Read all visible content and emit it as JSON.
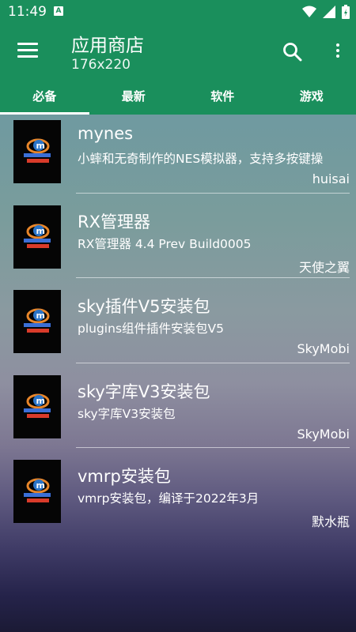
{
  "status": {
    "time": "11:49",
    "a_badge": "A"
  },
  "app_bar": {
    "title": "应用商店",
    "subtitle": "176x220"
  },
  "tabs": [
    {
      "label": "必备",
      "active": true
    },
    {
      "label": "最新",
      "active": false
    },
    {
      "label": "软件",
      "active": false
    },
    {
      "label": "游戏",
      "active": false
    }
  ],
  "items": [
    {
      "title": "mynes",
      "desc": "小蟀和无奇制作的NES模拟器，支持多按键操",
      "author": "huisai",
      "icon": "mrp-app-icon"
    },
    {
      "title": "RX管理器",
      "desc": "RX管理器 4.4 Prev Build0005",
      "author": "天使之翼",
      "icon": "mrp-app-icon"
    },
    {
      "title": "sky插件V5安装包",
      "desc": "plugins组件插件安装包V5",
      "author": "SkyMobi",
      "icon": "mrp-app-icon"
    },
    {
      "title": "sky字库V3安装包",
      "desc": "sky字库V3安装包",
      "author": "SkyMobi",
      "icon": "mrp-app-icon"
    },
    {
      "title": "vmrp安装包",
      "desc": "vmrp安装包，编译于2022年3月",
      "author": "默水瓶",
      "icon": "mrp-app-icon"
    }
  ],
  "colors": {
    "primary": "#1a8f5c",
    "text": "#ffffff"
  }
}
